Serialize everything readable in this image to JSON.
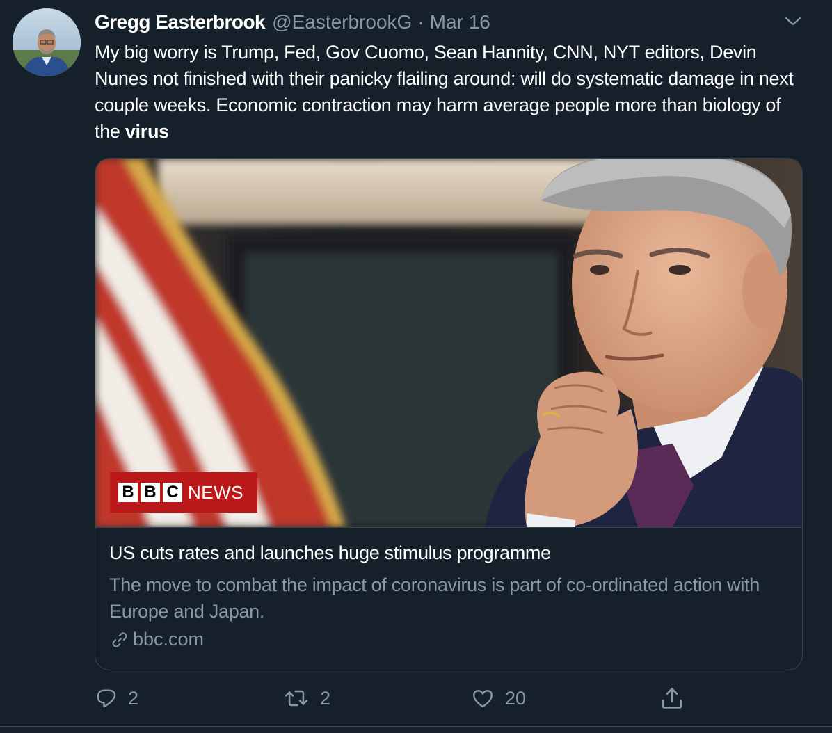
{
  "tweet": {
    "author_name": "Gregg Easterbrook",
    "author_handle": "@EasterbrookG",
    "separator": "·",
    "date": "Mar 16",
    "text_main": "My big worry is Trump, Fed, Gov Cuomo, Sean Hannity, CNN, NYT editors, Devin Nunes not finished with their panicky flailing around: will do systematic damage in next couple weeks. Economic contraction may harm average people more than biology of the ",
    "text_bold": "virus"
  },
  "card": {
    "title": "US cuts rates and launches huge stimulus programme",
    "description": "The move to combat the impact of coronavirus is part of co-ordinated action with Europe and Japan.",
    "domain": "bbc.com",
    "logo_letters": [
      "B",
      "B",
      "C"
    ],
    "logo_text": "NEWS"
  },
  "actions": {
    "reply_count": "2",
    "retweet_count": "2",
    "like_count": "20"
  },
  "icons": {
    "reply": "reply-icon",
    "retweet": "retweet-icon",
    "like": "heart-icon",
    "share": "share-icon",
    "more": "chevron-down-icon",
    "link": "link-icon"
  },
  "colors": {
    "background": "#15202b",
    "secondary_text": "#8899a6",
    "border": "#38444d",
    "bbc_red": "#bb1919"
  }
}
